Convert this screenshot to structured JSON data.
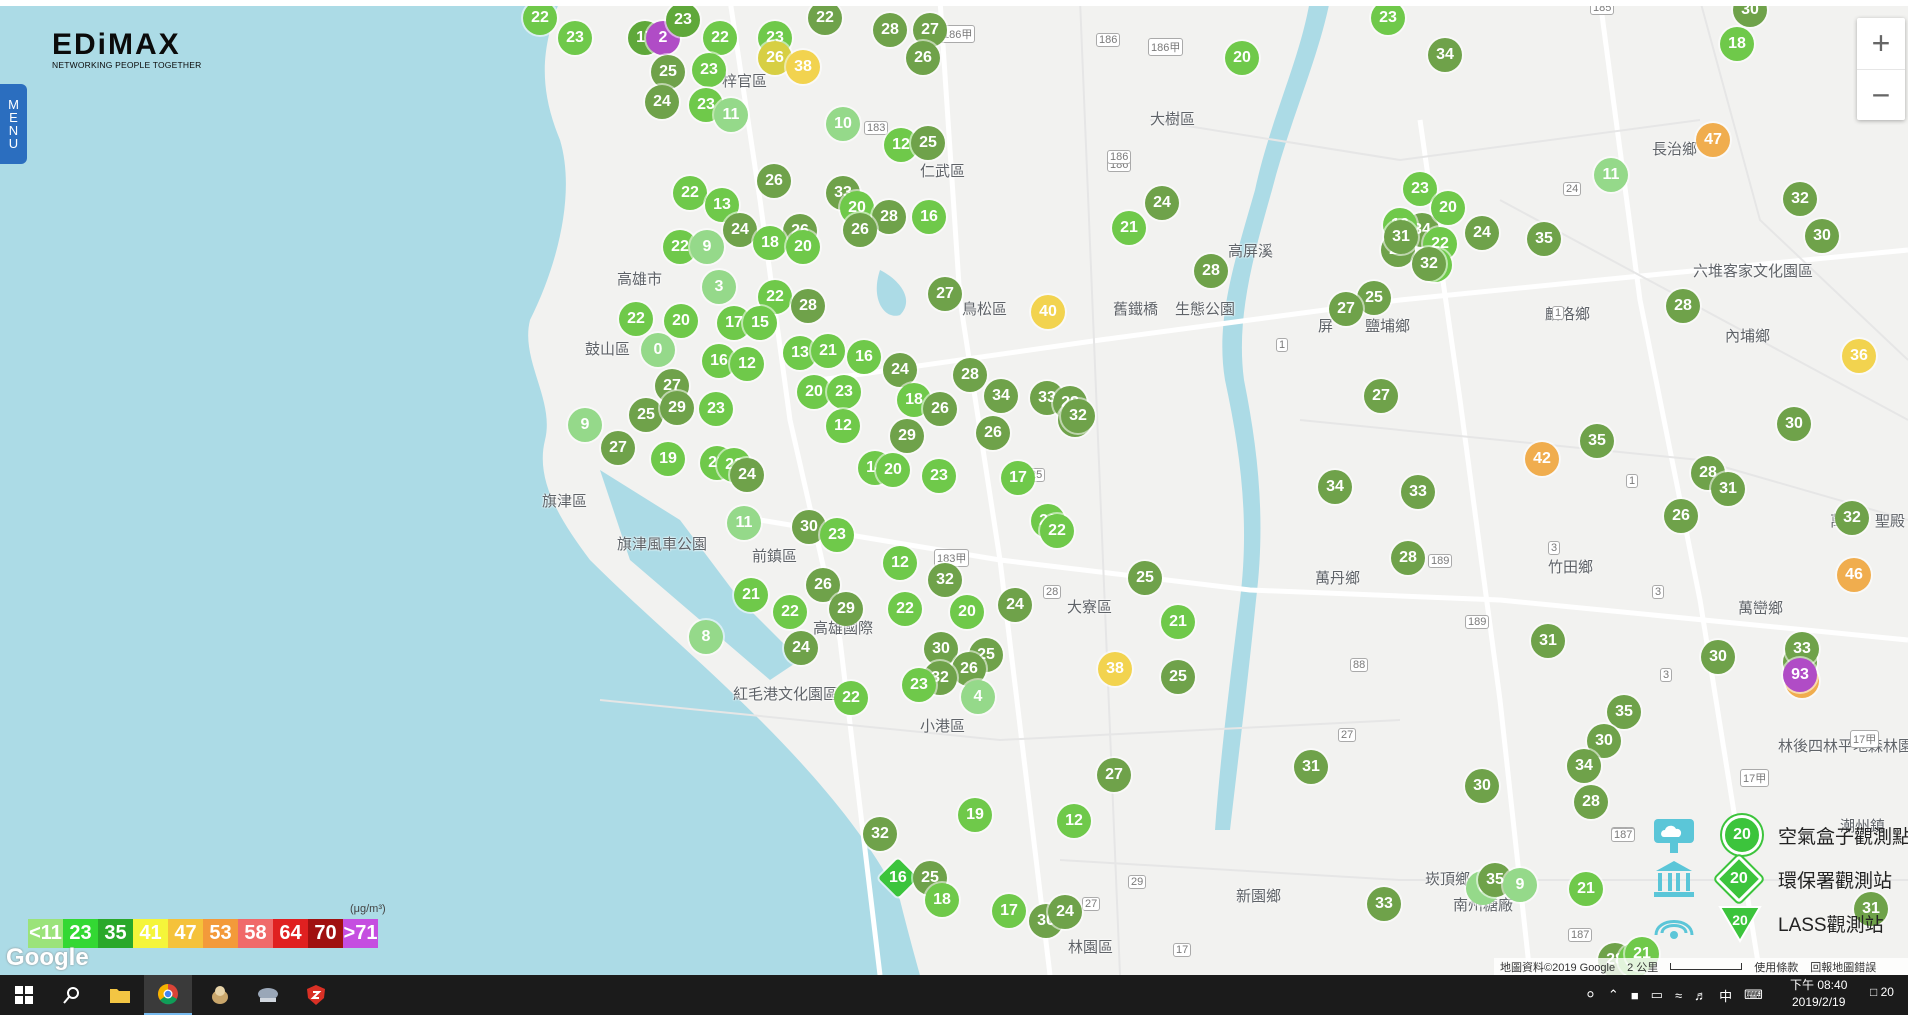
{
  "brand": {
    "name": "EDiMAX",
    "tagline": "NETWORKING PEOPLE TOGETHER"
  },
  "menu_label": [
    "M",
    "E",
    "N",
    "U"
  ],
  "zoom": {
    "in": "+",
    "out": "−"
  },
  "place_labels": [
    {
      "text": "梓官區"
    },
    {
      "text": "大樹區"
    },
    {
      "text": "仁武區"
    },
    {
      "text": "長治鄉"
    },
    {
      "text": "高雄市"
    },
    {
      "text": "鳥松區"
    },
    {
      "text": "舊鐵橋"
    },
    {
      "text": "生態公園"
    },
    {
      "text": "屏"
    },
    {
      "text": "鹽埔鄉"
    },
    {
      "text": "麟洛鄉"
    },
    {
      "text": "內埔鄉"
    },
    {
      "text": "六堆客家文化園區"
    },
    {
      "text": "鼓山區"
    },
    {
      "text": "旗津區"
    },
    {
      "text": "旗津風車公園"
    },
    {
      "text": "前鎮區"
    },
    {
      "text": "大寮區"
    },
    {
      "text": "萬丹鄉"
    },
    {
      "text": "竹田鄉"
    },
    {
      "text": "萬巒鄉"
    },
    {
      "text": "高雄國際"
    },
    {
      "text": "紅毛港文化園區"
    },
    {
      "text": "小港區"
    },
    {
      "text": "林後四林平地森林園區"
    },
    {
      "text": "崁頂鄉"
    },
    {
      "text": "南州糖廠"
    },
    {
      "text": "新園鄉"
    },
    {
      "text": "林園區"
    },
    {
      "text": "萬金"
    },
    {
      "text": "聖殿"
    },
    {
      "text": "潮州鎮"
    },
    {
      "text": "高屏溪"
    }
  ],
  "road_labels": [
    "186甲",
    "186甲",
    "186",
    "183",
    "186",
    "183甲",
    "25",
    "28",
    "186",
    "189",
    "189",
    "187",
    "187",
    "88",
    "27",
    "27",
    "29",
    "17",
    "1",
    "1",
    "3",
    "3",
    "3",
    "24",
    "1",
    "185",
    "187",
    "17甲",
    "17甲"
  ],
  "markers": [
    {
      "v": 22,
      "c": "#6fc94a"
    },
    {
      "v": 23,
      "c": "#6fc94a"
    },
    {
      "v": 17,
      "c": "#5fa83a"
    },
    {
      "v": 2,
      "c": "#b04cc6"
    },
    {
      "v": 23,
      "c": "#5fa83a"
    },
    {
      "v": 22,
      "c": "#6fc94a"
    },
    {
      "v": 23,
      "c": "#6fc94a"
    },
    {
      "v": 26,
      "c": "#d7cf43"
    },
    {
      "v": 22,
      "c": "#6fa24a"
    },
    {
      "v": 28,
      "c": "#6fa24a"
    },
    {
      "v": 27,
      "c": "#6fa24a"
    },
    {
      "v": 26,
      "c": "#6fa24a"
    },
    {
      "v": 25,
      "c": "#6fa24a"
    },
    {
      "v": 23,
      "c": "#6fc94a"
    },
    {
      "v": 24,
      "c": "#6fa24a"
    },
    {
      "v": 23,
      "c": "#6fc94a"
    },
    {
      "v": 11,
      "c": "#95d98a"
    },
    {
      "v": 10,
      "c": "#95d98a"
    },
    {
      "v": 12,
      "c": "#6fc94a"
    },
    {
      "v": 25,
      "c": "#6fa24a"
    },
    {
      "v": 20,
      "c": "#6fc94a"
    },
    {
      "v": 23,
      "c": "#6fc94a"
    },
    {
      "v": 38,
      "c": "#f2d34f"
    },
    {
      "v": 34,
      "c": "#6fa24a"
    },
    {
      "v": 26,
      "c": "#6fa24a"
    },
    {
      "v": 22,
      "c": "#6fc94a"
    },
    {
      "v": 13,
      "c": "#6fc94a"
    },
    {
      "v": 33,
      "c": "#6fa24a"
    },
    {
      "v": 20,
      "c": "#6fc94a"
    },
    {
      "v": 28,
      "c": "#6fa24a"
    },
    {
      "v": 26,
      "c": "#6fa24a"
    },
    {
      "v": 16,
      "c": "#6fc94a"
    },
    {
      "v": 24,
      "c": "#6fa24a"
    },
    {
      "v": 26,
      "c": "#6fa24a"
    },
    {
      "v": 18,
      "c": "#6fc94a"
    },
    {
      "v": 20,
      "c": "#6fc94a"
    },
    {
      "v": 22,
      "c": "#6fc94a"
    },
    {
      "v": 9,
      "c": "#95d98a"
    },
    {
      "v": 3,
      "c": "#95d98a"
    },
    {
      "v": 22,
      "c": "#6fc94a"
    },
    {
      "v": 28,
      "c": "#6fa24a"
    },
    {
      "v": 27,
      "c": "#6fa24a"
    },
    {
      "v": 40,
      "c": "#f2d34f"
    },
    {
      "v": 22,
      "c": "#6fc94a"
    },
    {
      "v": 20,
      "c": "#6fc94a"
    },
    {
      "v": 17,
      "c": "#6fc94a"
    },
    {
      "v": 15,
      "c": "#6fc94a"
    },
    {
      "v": 0,
      "c": "#95d98a"
    },
    {
      "v": 16,
      "c": "#6fc94a"
    },
    {
      "v": 12,
      "c": "#6fc94a"
    },
    {
      "v": 13,
      "c": "#6fc94a"
    },
    {
      "v": 21,
      "c": "#6fc94a"
    },
    {
      "v": 16,
      "c": "#6fc94a"
    },
    {
      "v": 24,
      "c": "#6fa24a"
    },
    {
      "v": 28,
      "c": "#6fa24a"
    },
    {
      "v": 27,
      "c": "#6fa24a"
    },
    {
      "v": 25,
      "c": "#6fa24a"
    },
    {
      "v": 29,
      "c": "#6fa24a"
    },
    {
      "v": 23,
      "c": "#6fc94a"
    },
    {
      "v": 20,
      "c": "#6fc94a"
    },
    {
      "v": 23,
      "c": "#6fc94a"
    },
    {
      "v": 18,
      "c": "#6fc94a"
    },
    {
      "v": 26,
      "c": "#6fa24a"
    },
    {
      "v": 33,
      "c": "#6fa24a"
    },
    {
      "v": 28,
      "c": "#6fa24a"
    },
    {
      "v": 28,
      "c": "#6fa24a"
    },
    {
      "v": 9,
      "c": "#95d98a"
    },
    {
      "v": 27,
      "c": "#6fa24a"
    },
    {
      "v": 19,
      "c": "#6fc94a"
    },
    {
      "v": 23,
      "c": "#6fc94a"
    },
    {
      "v": 22,
      "c": "#6fc94a"
    },
    {
      "v": 12,
      "c": "#6fc94a"
    },
    {
      "v": 29,
      "c": "#6fa24a"
    },
    {
      "v": 26,
      "c": "#6fa24a"
    },
    {
      "v": 24,
      "c": "#6fa24a"
    },
    {
      "v": 14,
      "c": "#6fc94a"
    },
    {
      "v": 20,
      "c": "#6fc94a"
    },
    {
      "v": 23,
      "c": "#6fc94a"
    },
    {
      "v": 17,
      "c": "#6fc94a"
    },
    {
      "v": 11,
      "c": "#95d98a"
    },
    {
      "v": 30,
      "c": "#6fa24a"
    },
    {
      "v": 23,
      "c": "#6fc94a"
    },
    {
      "v": 12,
      "c": "#6fc94a"
    },
    {
      "v": 20,
      "c": "#6fc94a"
    },
    {
      "v": 22,
      "c": "#6fc94a"
    },
    {
      "v": 32,
      "c": "#6fa24a"
    },
    {
      "v": 21,
      "c": "#6fc94a"
    },
    {
      "v": 22,
      "c": "#6fc94a"
    },
    {
      "v": 26,
      "c": "#6fa24a"
    },
    {
      "v": 29,
      "c": "#6fa24a"
    },
    {
      "v": 22,
      "c": "#6fc94a"
    },
    {
      "v": 20,
      "c": "#6fc94a"
    },
    {
      "v": 24,
      "c": "#6fa24a"
    },
    {
      "v": 25,
      "c": "#6fa24a"
    },
    {
      "v": 21,
      "c": "#6fc94a"
    },
    {
      "v": 8,
      "c": "#95d98a"
    },
    {
      "v": 24,
      "c": "#6fa24a"
    },
    {
      "v": 30,
      "c": "#6fa24a"
    },
    {
      "v": 25,
      "c": "#6fa24a"
    },
    {
      "v": 26,
      "c": "#6fa24a"
    },
    {
      "v": 32,
      "c": "#6fa24a"
    },
    {
      "v": 38,
      "c": "#f2d34f"
    },
    {
      "v": 23,
      "c": "#6fc94a"
    },
    {
      "v": 4,
      "c": "#95d98a"
    },
    {
      "v": 22,
      "c": "#6fc94a"
    },
    {
      "v": 25,
      "c": "#6fa24a"
    },
    {
      "v": 27,
      "c": "#6fa24a"
    },
    {
      "v": 19,
      "c": "#6fc94a"
    },
    {
      "v": 12,
      "c": "#6fc94a"
    },
    {
      "v": 32,
      "c": "#6fa24a"
    },
    {
      "v": 16,
      "c": "#3cc43c",
      "shape": "diamond"
    },
    {
      "v": 25,
      "c": "#6fa24a"
    },
    {
      "v": 18,
      "c": "#6fc94a"
    },
    {
      "v": 17,
      "c": "#6fc94a"
    },
    {
      "v": 30,
      "c": "#6fa24a"
    },
    {
      "v": 24,
      "c": "#6fa24a"
    },
    {
      "v": 25,
      "c": "#6fa24a"
    },
    {
      "v": 27,
      "c": "#6fa24a"
    },
    {
      "v": 28,
      "c": "#6fa24a"
    },
    {
      "v": 24,
      "c": "#6fa24a"
    },
    {
      "v": 21,
      "c": "#6fc94a"
    },
    {
      "v": 23,
      "c": "#6fc94a"
    },
    {
      "v": 34,
      "c": "#6fa24a"
    },
    {
      "v": 20,
      "c": "#6fc94a"
    },
    {
      "v": 16,
      "c": "#6fc94a"
    },
    {
      "v": 29,
      "c": "#6fa24a"
    },
    {
      "v": 22,
      "c": "#6fc94a"
    },
    {
      "v": 24,
      "c": "#6fa24a"
    },
    {
      "v": 23,
      "c": "#6fc94a"
    },
    {
      "v": 32,
      "c": "#6fa24a"
    },
    {
      "v": 31,
      "c": "#6fa24a"
    },
    {
      "v": 35,
      "c": "#6fa24a"
    },
    {
      "v": 11,
      "c": "#95d98a"
    },
    {
      "v": 47,
      "c": "#f0ad4e"
    },
    {
      "v": 32,
      "c": "#6fa24a"
    },
    {
      "v": 30,
      "c": "#6fa24a"
    },
    {
      "v": 28,
      "c": "#6fa24a"
    },
    {
      "v": 36,
      "c": "#f2d34f"
    },
    {
      "v": 27,
      "c": "#6fa24a"
    },
    {
      "v": 35,
      "c": "#6fa24a"
    },
    {
      "v": 42,
      "c": "#f0ad4e"
    },
    {
      "v": 30,
      "c": "#6fa24a"
    },
    {
      "v": 28,
      "c": "#6fa24a"
    },
    {
      "v": 31,
      "c": "#6fa24a"
    },
    {
      "v": 26,
      "c": "#6fa24a"
    },
    {
      "v": 32,
      "c": "#6fa24a"
    },
    {
      "v": 33,
      "c": "#6fa24a"
    },
    {
      "v": 34,
      "c": "#6fa24a"
    },
    {
      "v": 28,
      "c": "#6fa24a"
    },
    {
      "v": 46,
      "c": "#f0ad4e"
    },
    {
      "v": 32,
      "c": "#6fa24a"
    },
    {
      "v": 31,
      "c": "#6fa24a"
    },
    {
      "v": 30,
      "c": "#6fa24a"
    },
    {
      "v": 33,
      "c": "#6fa24a"
    },
    {
      "v": 42,
      "c": "#f0ad4e"
    },
    {
      "v": 93,
      "c": "#b04cc6"
    },
    {
      "v": 35,
      "c": "#6fa24a"
    },
    {
      "v": 30,
      "c": "#6fa24a"
    },
    {
      "v": 34,
      "c": "#6fa24a"
    },
    {
      "v": 28,
      "c": "#6fa24a"
    },
    {
      "v": 30,
      "c": "#6fa24a"
    },
    {
      "v": 31,
      "c": "#6fa24a"
    },
    {
      "v": 0,
      "c": "#95d98a"
    },
    {
      "v": 35,
      "c": "#6fa24a"
    },
    {
      "v": 9,
      "c": "#95d98a"
    },
    {
      "v": 21,
      "c": "#6fc94a"
    },
    {
      "v": 33,
      "c": "#6fa24a"
    },
    {
      "v": 31,
      "c": "#6fa24a"
    },
    {
      "v": 28,
      "c": "#6fa24a"
    },
    {
      "v": 23,
      "c": "#6fc94a"
    },
    {
      "v": 21,
      "c": "#6fc94a"
    },
    {
      "v": 30,
      "c": "#6fa24a"
    },
    {
      "v": 18,
      "c": "#6fc94a"
    },
    {
      "v": 34,
      "c": "#6fa24a"
    },
    {
      "v": 32,
      "c": "#6fa24a"
    },
    {
      "v": 20,
      "c": "#6fc94a"
    },
    {
      "v": 34,
      "c": "#6fa24a"
    },
    {
      "v": 23,
      "c": "#6fc94a"
    },
    {
      "v": 38,
      "c": "#f2d34f"
    },
    {
      "v": 28,
      "c": "#6fa24a"
    },
    {
      "v": 33,
      "c": "#6fa24a",
      "shape": "tri"
    },
    {
      "v": 25,
      "c": "#6fa24a"
    },
    {
      "v": 28,
      "c": "#6fa24a",
      "shape": "tri"
    }
  ],
  "legend_scale": {
    "unit": "(μg/m³)",
    "cells": [
      {
        "label": "<11",
        "color": "#9be37a"
      },
      {
        "label": "23",
        "color": "#33d833"
      },
      {
        "label": "35",
        "color": "#2aa82a"
      },
      {
        "label": "41",
        "color": "#f5f53a"
      },
      {
        "label": "47",
        "color": "#f5c23a"
      },
      {
        "label": "53",
        "color": "#f39a3a"
      },
      {
        "label": "58",
        "color": "#f06a6a"
      },
      {
        "label": "64",
        "color": "#e02020"
      },
      {
        "label": "70",
        "color": "#a01010"
      },
      {
        "label": ">71",
        "color": "#c54ee0"
      }
    ]
  },
  "legend_types": [
    {
      "badge": "20",
      "text": "空氣盒子觀測點"
    },
    {
      "badge": "20",
      "text": "環保署觀測站"
    },
    {
      "badge": "20",
      "text": "LASS觀測站"
    }
  ],
  "google_logo": "Google",
  "attribution": {
    "data": "地圖資料©2019 Google",
    "scale": "2 公里",
    "terms": "使用條款",
    "report": "回報地圖錯誤"
  },
  "taskbar": {
    "time": "下午 08:40",
    "date": "2019/2/19",
    "ime": "中",
    "notif_count": "20"
  }
}
